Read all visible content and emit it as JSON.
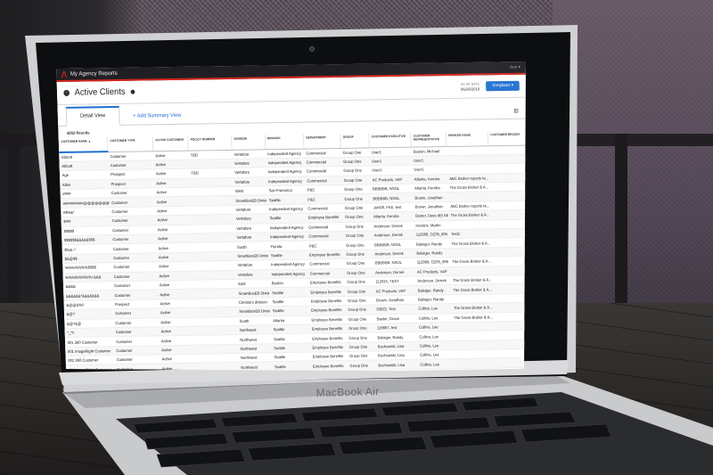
{
  "app": {
    "title": "My Agency Reports",
    "user_menu": "Ann ▾",
    "page_title": "Active Clients",
    "as_of_label": "AS OF DATE",
    "as_of_date": "06/28/2018",
    "templates_button": "Templates ▾",
    "tabs": [
      "Detail View",
      "+ Add Summary View"
    ],
    "results": "4282 Results"
  },
  "table": {
    "columns": [
      "CUSTOMER NAME ▲",
      "CUSTOMER TYPE",
      "ACTIVE CUSTOMER",
      "POLICY NUMBER",
      "DIVISION",
      "BRANCH",
      "DEPARTMENT",
      "GROUP",
      "CUSTOMER EXECUTIVE",
      "CUSTOMER REPRESENTATIVE",
      "BROKER NAME",
      "CUSTOMER REGION"
    ],
    "rows": [
      [
        "Abbott",
        "Customer",
        "Active",
        "TBD",
        "Vertafore",
        "Independent Agency",
        "Commercial",
        "Group One",
        "User1",
        "Boston, Michael",
        "",
        ""
      ],
      [
        "Abbott",
        "Customer",
        "Active",
        "",
        "Vertafore",
        "Independent Agency",
        "Commercial",
        "Group One",
        "User1",
        "User1",
        "",
        ""
      ],
      [
        "Age",
        "Prospect",
        "Active",
        "TBD",
        "Vertafore",
        "Independent Agency",
        "Commercial",
        "Group One",
        "User1",
        "User1",
        "",
        ""
      ],
      [
        "Allen",
        "Prospect",
        "Active",
        "",
        "Vertafore",
        "Independent Agency",
        "Commercial",
        "Group One",
        "AC Products, VAP",
        "Atlanta, Kendra",
        "ABC Broker reports ta...",
        ""
      ],
      [
        "####",
        "Customer",
        "Active",
        "",
        "West",
        "San Francisco",
        "P&C",
        "Group One",
        "BBBBBB, NSOL",
        "Atlanta, Kendra",
        "The Gross Broker & A...",
        ""
      ],
      [
        "##########@@@@@@@@@@@@",
        "Customer",
        "Active",
        "",
        "SmartBoxEB Division",
        "Seattle",
        "P&C",
        "Group One",
        "BBBBBB, NSOL",
        "Brown, Jonathan",
        "",
        ""
      ],
      [
        "#$%&*",
        "Customer",
        "Active",
        "",
        "Vertafore",
        "Independent Agency",
        "Commercial",
        "Group One",
        "Juhl38, FKE, test",
        "Brown, Jonathan",
        "ABC Broker reports ta...",
        ""
      ],
      [
        "$!##",
        "Customer",
        "Active",
        "",
        "Vertafore",
        "Seattle",
        "Employee Benefits",
        "Group One",
        "Atlanta, Kendra",
        "Baxter, Dave  dE/ ABC",
        "The Gross Broker & A...",
        ""
      ],
      [
        "$$$$$",
        "Customer",
        "Active",
        "",
        "Vertafore",
        "Independent Agency",
        "Commercial",
        "Group One",
        "Anderson, Derrek",
        "Hendrix, Martin",
        "",
        ""
      ],
      [
        "$$$$$$&&&&&$$$",
        "Customer",
        "Active",
        "",
        "Vertafore",
        "Independent Agency",
        "Commercial",
        "Group One",
        "Anderson, Derrek",
        "112968, OZ05_805",
        "Test1",
        ""
      ],
      [
        "$%&~*",
        "Customer",
        "Active",
        "",
        "South",
        "Florida",
        "P&C",
        "Group One",
        "BBBBBB, NSOL",
        "Balsiger, Randy",
        "The Gross Broker & A...",
        ""
      ],
      [
        "$&@$$",
        "Customer",
        "Active",
        "",
        "SmartBoxEB Division",
        "Seattle",
        "Employee Benefits",
        "Group One",
        "Anderson, Derrek",
        "Balsiger, Randy",
        "",
        ""
      ],
      [
        "%%%%%%%$$$$",
        "Customer",
        "Active",
        "",
        "Vertafore",
        "Independent Agency",
        "Commercial",
        "Group One",
        "BBBBBB, NSOL",
        "112968, OZ05_805",
        "The Gross Broker & A...",
        ""
      ],
      [
        "%%%%%%%%+&&&",
        "Customer",
        "Active",
        "",
        "Vertafore",
        "Independent Agency",
        "Commercial",
        "Group One",
        "Anderson, Derrek",
        "AC Products, VAP",
        "",
        ""
      ],
      [
        "&&&&",
        "Customer",
        "Active",
        "",
        "East",
        "Boston",
        "Employee Benefits",
        "Group One",
        "112915, TEST",
        "Anderson, Derrek",
        "The Gross Broker & A...",
        ""
      ],
      [
        "&&&&&&*&&&&&&&",
        "Customer",
        "Active",
        "",
        "SmartBoxEB Division",
        "Seattle",
        "Employee Benefits",
        "Group One",
        "AC Products, VAP",
        "Balsiger, Randy",
        "The Gross Broker & A...",
        ""
      ],
      [
        "&@@&%!!",
        "Prospect",
        "Active",
        "",
        "Christie's division",
        "Seattle",
        "Employee Benefits",
        "Group One",
        "Brown, Jonathan",
        "Balsiger, Randy",
        "",
        ""
      ],
      [
        "&@?",
        "Customer",
        "Active",
        "",
        "SmartBoxEB Division",
        "Seattle",
        "Employee Benefits",
        "Group One",
        "83822, Test",
        "Collins, Lee",
        "The Gross Broker & A...",
        ""
      ],
      [
        "&@?&@",
        "Customer",
        "Active",
        "",
        "South",
        "Atlanta",
        "Employee Benefits",
        "Group One",
        "Baxter, Grace",
        "Collins, Lee",
        "The Gross Broker & A...",
        ""
      ],
      [
        "*_*!!",
        "Customer",
        "Active",
        "",
        "Northwest",
        "Seattle",
        "Employee Benefits",
        "Group One",
        "116687, test",
        "Collins, Lee",
        "",
        ""
      ],
      [
        "001 360 Customer",
        "Customer",
        "Active",
        "",
        "Northwest",
        "Seattle",
        "Employee Benefits",
        "Group One",
        "Balsiger, Randy",
        "Collins, Lee",
        "",
        ""
      ],
      [
        "001 ImageRight Customer",
        "Customer",
        "Active",
        "",
        "Northwest",
        "Seattle",
        "Employee Benefits",
        "Group One",
        "Bochowski, Lisa",
        "Collins, Lee",
        "",
        ""
      ],
      [
        "002 360 Customer",
        "Customer",
        "Active",
        "",
        "Northwest",
        "Seattle",
        "Employee Benefits",
        "Group One",
        "Bochowski, Lisa",
        "Collins, Lee",
        "",
        ""
      ],
      [
        "002 ImageRight Customer",
        "Customer",
        "Active",
        "",
        "Northwest",
        "Seattle",
        "Employee Benefits",
        "Group One",
        "Bochowski, Lisa",
        "Collins, Lee",
        "",
        ""
      ]
    ]
  },
  "device": {
    "brand": "MacBook Air"
  },
  "colors": {
    "accent": "#1f6fd1",
    "brand_red": "#d7261e",
    "app_bar": "#1f1f23"
  }
}
